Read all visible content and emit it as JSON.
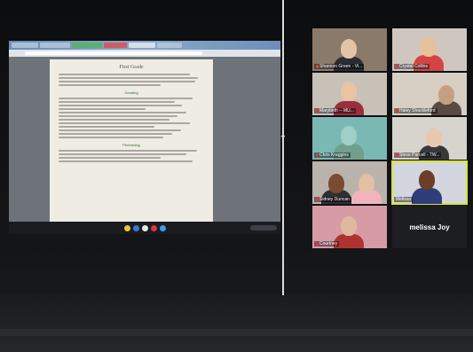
{
  "document": {
    "title": "First Grade",
    "sections": [
      "Creating",
      "Performing"
    ]
  },
  "participants": [
    {
      "name": "Shannon Green - Vi...",
      "muted": true,
      "speaking": false
    },
    {
      "name": "Crystal Collins",
      "muted": true,
      "speaking": false
    },
    {
      "name": "Marybeth -- MU...",
      "muted": true,
      "speaking": false
    },
    {
      "name": "Haley Shackleford",
      "muted": true,
      "speaking": false
    },
    {
      "name": "Chris Kraggins",
      "muted": true,
      "speaking": false
    },
    {
      "name": "Steve Parcell - TW...",
      "muted": true,
      "speaking": false
    },
    {
      "name": "Sidney Duncan",
      "muted": true,
      "speaking": false
    },
    {
      "name": "Melissa",
      "muted": false,
      "speaking": true
    },
    {
      "name": "Courtney",
      "muted": true,
      "speaking": false
    }
  ],
  "video_off_participant": "melissa Joy",
  "colors": {
    "speaking_outline": "#d8e43a",
    "mute_indicator": "#e23a3a"
  }
}
